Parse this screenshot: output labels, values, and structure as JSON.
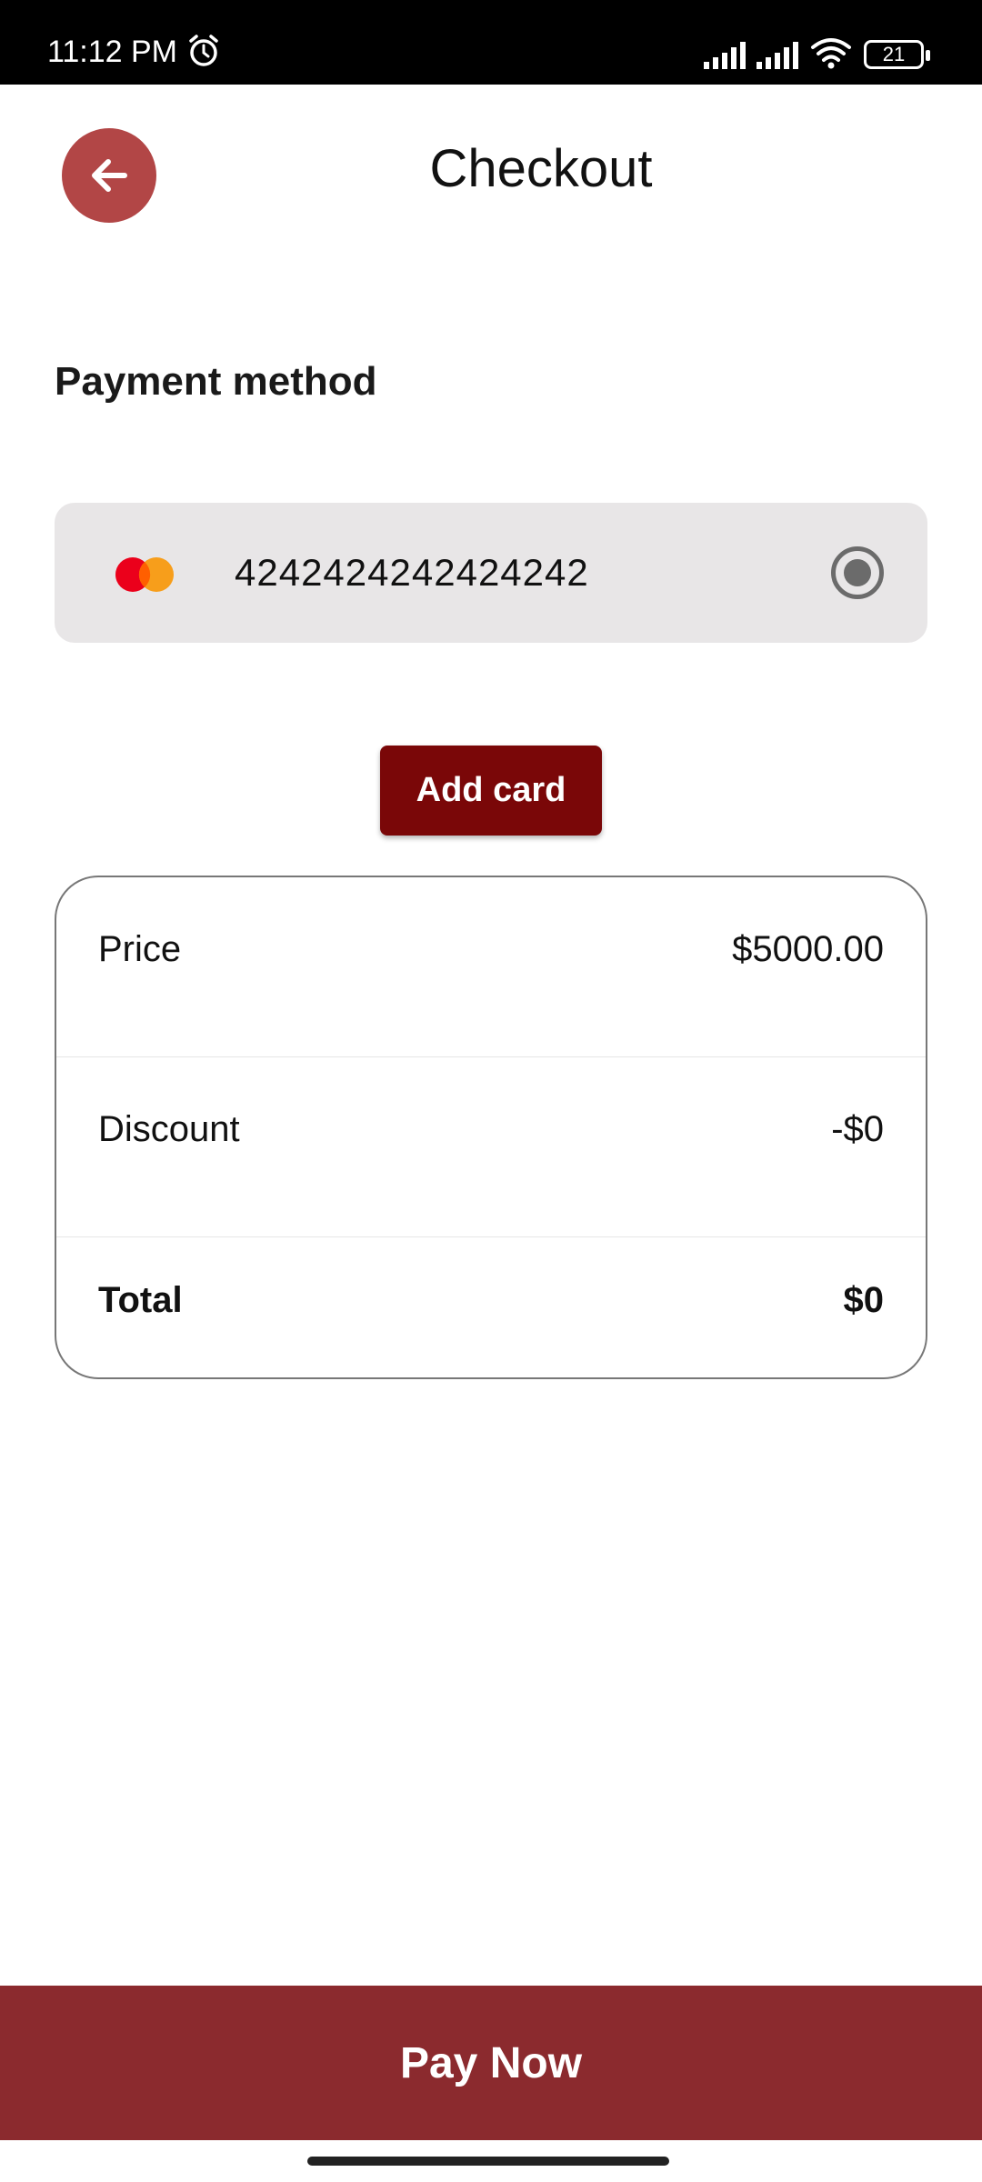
{
  "status_bar": {
    "time": "11:12 PM",
    "battery": "21",
    "icons": [
      "alarm-icon",
      "signal-icon",
      "signal-icon",
      "wifi-icon",
      "battery-icon"
    ]
  },
  "header": {
    "title": "Checkout",
    "back_icon": "arrow-left-icon"
  },
  "payment": {
    "section_title": "Payment method",
    "card": {
      "brand_icon": "mastercard-logo",
      "number": "4242424242424242",
      "selected": true
    },
    "add_card_label": "Add card"
  },
  "summary": {
    "rows": [
      {
        "label": "Price",
        "value": "$5000.00"
      },
      {
        "label": "Discount",
        "value": "-$0"
      },
      {
        "label": "Total",
        "value": "$0"
      }
    ]
  },
  "footer": {
    "pay_label": "Pay Now"
  },
  "colors": {
    "accent": "#7a0708",
    "pay_button": "#8b2a2e",
    "back_button": "#b24646",
    "card_bg": "#e8e6e7"
  }
}
